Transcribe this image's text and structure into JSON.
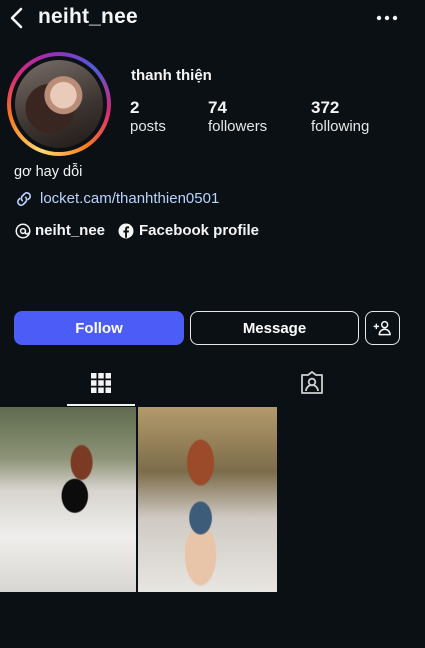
{
  "header": {
    "username": "neiht_nee",
    "back_icon": "chevron-left-icon",
    "more_icon": "more-horizontal-icon"
  },
  "profile": {
    "full_name": "thanh thiện",
    "stats": [
      {
        "value": "2",
        "label": "posts"
      },
      {
        "value": "74",
        "label": "followers"
      },
      {
        "value": "372",
        "label": "following"
      }
    ],
    "bio": "gơ hay dỗi",
    "link": "locket.cam/thanhthien0501",
    "threads_handle": "neiht_nee",
    "facebook_label": "Facebook profile"
  },
  "actions": {
    "follow_label": "Follow",
    "message_label": "Message"
  },
  "colors": {
    "background": "#0b1014",
    "follow_button": "#4c5cf7",
    "link": "#b9d3ff"
  }
}
